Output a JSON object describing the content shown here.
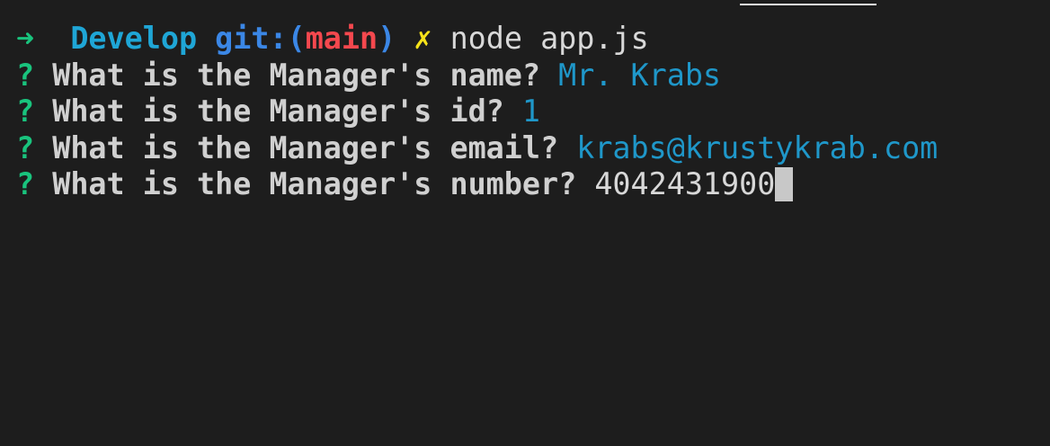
{
  "prompt": {
    "arrow": "➜",
    "directory": "Develop",
    "git_label": "git:",
    "paren_open": "(",
    "branch": "main",
    "paren_close": ")",
    "dirty_mark": "✗",
    "command": "node app.js"
  },
  "questions": [
    {
      "marker": "?",
      "text": "What is the Manager's name?",
      "answer": "Mr. Krabs"
    },
    {
      "marker": "?",
      "text": "What is the Manager's id?",
      "answer": "1"
    },
    {
      "marker": "?",
      "text": "What is the Manager's email?",
      "answer": "krabs@krustykrab.com"
    },
    {
      "marker": "?",
      "text": "What is the Manager's number?",
      "answer": "4042431900"
    }
  ],
  "colors": {
    "background": "#1d1d1d",
    "prompt_arrow": "#19c37d",
    "directory": "#1fa6d6",
    "git_label": "#3b87e6",
    "branch": "#f4484e",
    "dirty_mark": "#f5e21a",
    "answer": "#1f97c9"
  }
}
